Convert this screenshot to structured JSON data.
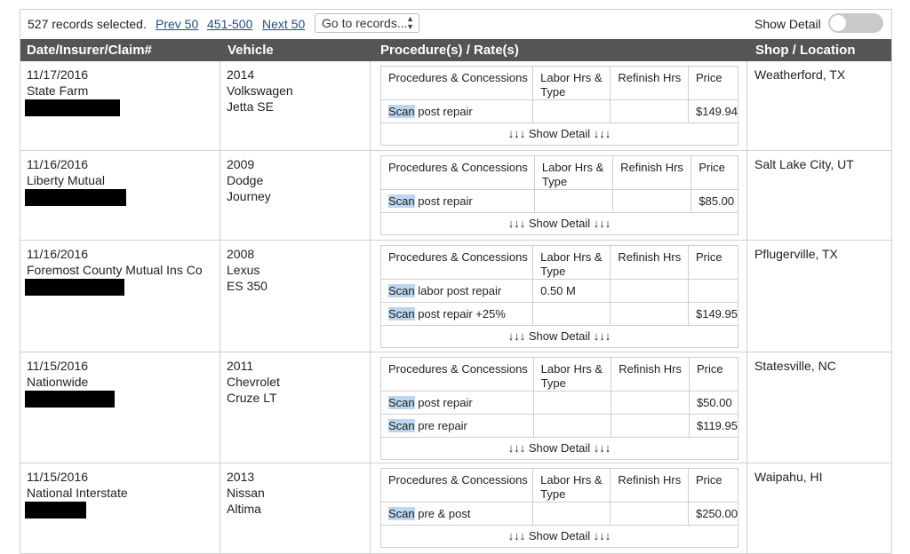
{
  "toolbar": {
    "count_text": "527 records selected.",
    "prev_label": "Prev 50",
    "range_label": "451-500",
    "next_label": "Next 50",
    "goto_label": "Go to records...",
    "show_detail_label": "Show Detail",
    "show_detail_on": false
  },
  "columns": [
    "Date/Insurer/Claim#",
    "Vehicle",
    "Procedure(s) / Rate(s)",
    "Shop / Location"
  ],
  "inner_headers": [
    "Procedures & Concessions",
    "Labor Hrs & Type",
    "Refinish Hrs",
    "Price"
  ],
  "highlight_word": "Scan",
  "show_detail_link": "↓↓↓ Show Detail ↓↓↓",
  "records": [
    {
      "date": "11/17/2016",
      "insurer": "State Farm",
      "vehicle": [
        "2014",
        "Volkswagen",
        "Jetta SE"
      ],
      "location": "Weatherford, TX",
      "procedures": [
        {
          "rest": " post repair",
          "labor": "",
          "refinish": "",
          "price": "$149.94"
        }
      ]
    },
    {
      "date": "11/16/2016",
      "insurer": "Liberty Mutual",
      "vehicle": [
        "2009",
        "Dodge",
        "Journey"
      ],
      "location": "Salt Lake City, UT",
      "procedures": [
        {
          "rest": " post repair",
          "labor": "",
          "refinish": "",
          "price": "$85.00"
        }
      ]
    },
    {
      "date": "11/16/2016",
      "insurer": "Foremost County Mutual Ins Co",
      "vehicle": [
        "2008",
        "Lexus",
        "ES 350"
      ],
      "location": "Pflugerville, TX",
      "procedures": [
        {
          "rest": " labor post repair",
          "labor": "0.50 M",
          "refinish": "",
          "price": ""
        },
        {
          "rest": " post repair +25%",
          "labor": "",
          "refinish": "",
          "price": "$149.95"
        }
      ]
    },
    {
      "date": "11/15/2016",
      "insurer": "Nationwide",
      "vehicle": [
        "2011",
        "Chevrolet",
        "Cruze LT"
      ],
      "location": "Statesville, NC",
      "procedures": [
        {
          "rest": " post repair",
          "labor": "",
          "refinish": "",
          "price": "$50.00"
        },
        {
          "rest": " pre repair",
          "labor": "",
          "refinish": "",
          "price": "$119.95"
        }
      ]
    },
    {
      "date": "11/15/2016",
      "insurer": "National Interstate",
      "vehicle": [
        "2013",
        "Nissan",
        "Altima"
      ],
      "location": "Waipahu, HI",
      "procedures": [
        {
          "rest": " pre & post",
          "labor": "",
          "refinish": "",
          "price": "$250.00"
        }
      ]
    }
  ]
}
